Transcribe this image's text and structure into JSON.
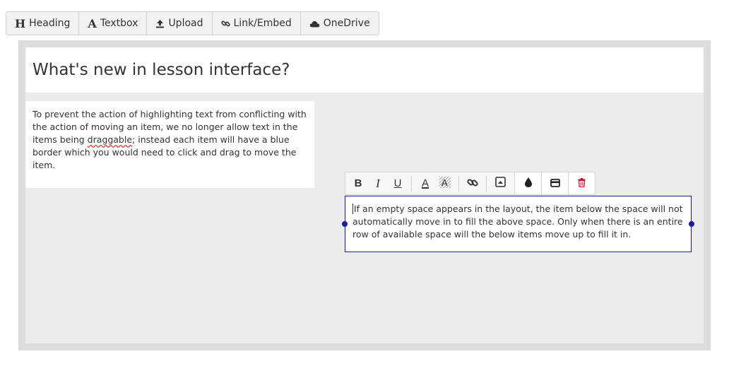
{
  "toolbar": {
    "items": [
      {
        "label": "Heading",
        "icon": "heading-icon",
        "glyph": "H"
      },
      {
        "label": "Textbox",
        "icon": "textbox-icon",
        "glyph": "A"
      },
      {
        "label": "Upload",
        "icon": "upload-icon"
      },
      {
        "label": "Link/Embed",
        "icon": "link-icon"
      },
      {
        "label": "OneDrive",
        "icon": "cloud-icon"
      }
    ]
  },
  "lesson": {
    "title": "What's new in lesson interface?",
    "block1": {
      "text_before": "To prevent the action of highlighting text from conflicting with the action of moving an item, we no longer allow text in the items being ",
      "misspelled_word": "draggable",
      "text_after": "; instead each item will have a blue border which you would need to click and drag to move the item."
    },
    "block2": {
      "text": "If an empty space appears in the layout, the item below the space will not automatically move in to fill the above space. Only when there is an entire row of available space will the below items move up to fill it in."
    }
  },
  "format_toolbar": {
    "bold": "B",
    "italic": "I",
    "underline": "U",
    "font_color": "A"
  },
  "colors": {
    "selection_border": "#1a1aa8",
    "delete_icon": "#c0182a",
    "canvas_bg": "#ececec"
  }
}
